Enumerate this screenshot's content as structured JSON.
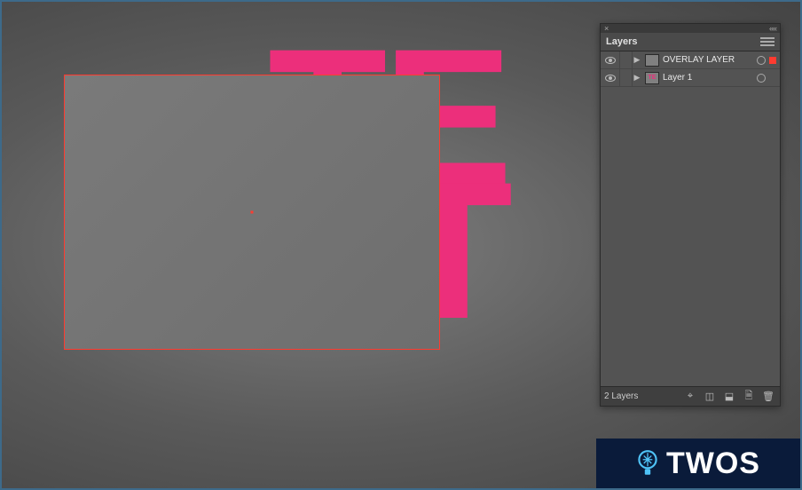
{
  "panel": {
    "title": "Layers",
    "footer_label": "2 Layers",
    "layers": [
      {
        "name": "OVERLAY LAYER",
        "selected": true,
        "color": "#ff3b30",
        "thumb": ""
      },
      {
        "name": "Layer 1",
        "selected": false,
        "color": "#ec2f7b",
        "thumb": "TE"
      }
    ]
  },
  "artwork": {
    "line1": "TE",
    "line2": "ST"
  },
  "watermark": {
    "text": "TWOS"
  },
  "icons": {
    "close": "×",
    "collapse": "««",
    "locate": "⌖",
    "clip_mask": "◫",
    "new_sublayer": "⬓",
    "new_layer": "🗎",
    "trash": "🗑"
  }
}
